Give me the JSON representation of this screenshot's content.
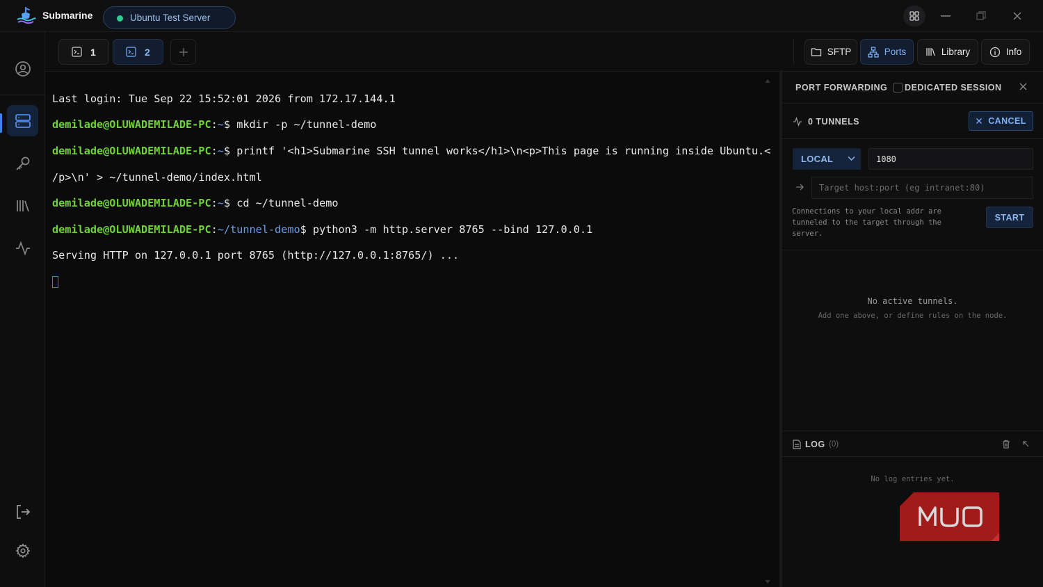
{
  "app": {
    "name": "Submarine"
  },
  "server": {
    "name": "Ubuntu Test Server",
    "status_color": "#2ecc8a"
  },
  "window_controls": [
    "apps-grid-icon",
    "minimize-icon",
    "restore-icon",
    "close-icon"
  ],
  "sidebar": {
    "items": [
      {
        "icon": "profile-icon",
        "active": false
      },
      {
        "icon": "servers-icon",
        "active": true
      },
      {
        "icon": "key-icon",
        "active": false
      },
      {
        "icon": "library-icon",
        "active": false
      },
      {
        "icon": "activity-icon",
        "active": false
      }
    ],
    "bottom": [
      {
        "icon": "logout-icon"
      },
      {
        "icon": "settings-icon"
      }
    ]
  },
  "tabs": [
    {
      "label": "1",
      "icon": "terminal-icon",
      "active": false
    },
    {
      "label": "2",
      "icon": "terminal-icon",
      "active": true
    }
  ],
  "toolbar": {
    "sftp_label": "SFTP",
    "ports_label": "Ports",
    "library_label": "Library",
    "info_label": "Info",
    "active": "Ports"
  },
  "terminal": {
    "line1": "Last login: Tue Sep 22 15:52:01 2026 from 172.17.144.1",
    "user_host": "demilade@OLUWADEMILADE-PC",
    "home_path": "~",
    "demo_path": "~/tunnel-demo",
    "cmd1": "mkdir -p ~/tunnel-demo",
    "cmd2a": "printf '<h1>Submarine SSH tunnel works</h1>\\n<p>This page is running inside Ubuntu.<",
    "cmd2b": "/p>\\n' > ~/tunnel-demo/index.html",
    "cmd3": "cd ~/tunnel-demo",
    "cmd4": "python3 -m http.server 8765 --bind 127.0.0.1",
    "output1": "Serving HTTP on 127.0.0.1 port 8765 (http://127.0.0.1:8765/) ..."
  },
  "port_forwarding": {
    "title": "PORT FORWARDING",
    "dedicated_label": "DEDICATED SESSION",
    "dedicated_checked": false,
    "tunnel_count": "0 TUNNELS",
    "cancel_label": "CANCEL",
    "mode": "LOCAL",
    "local_port": "1080",
    "target_placeholder": "Target host:port (eg intranet:80)",
    "help": "Connections to your local addr are tunneled to the target through the server.",
    "start_label": "START",
    "empty_title": "No active tunnels.",
    "empty_sub": "Add one above, or define rules on the node."
  },
  "log": {
    "title": "LOG",
    "count": "(0)",
    "empty": "No log entries yet."
  },
  "watermark": {
    "text": "MUO",
    "color": "#a11b1b"
  },
  "colors": {
    "accent": "#3a82f0",
    "prompt_user": "#6fd23a",
    "prompt_path": "#6a9ee6"
  }
}
